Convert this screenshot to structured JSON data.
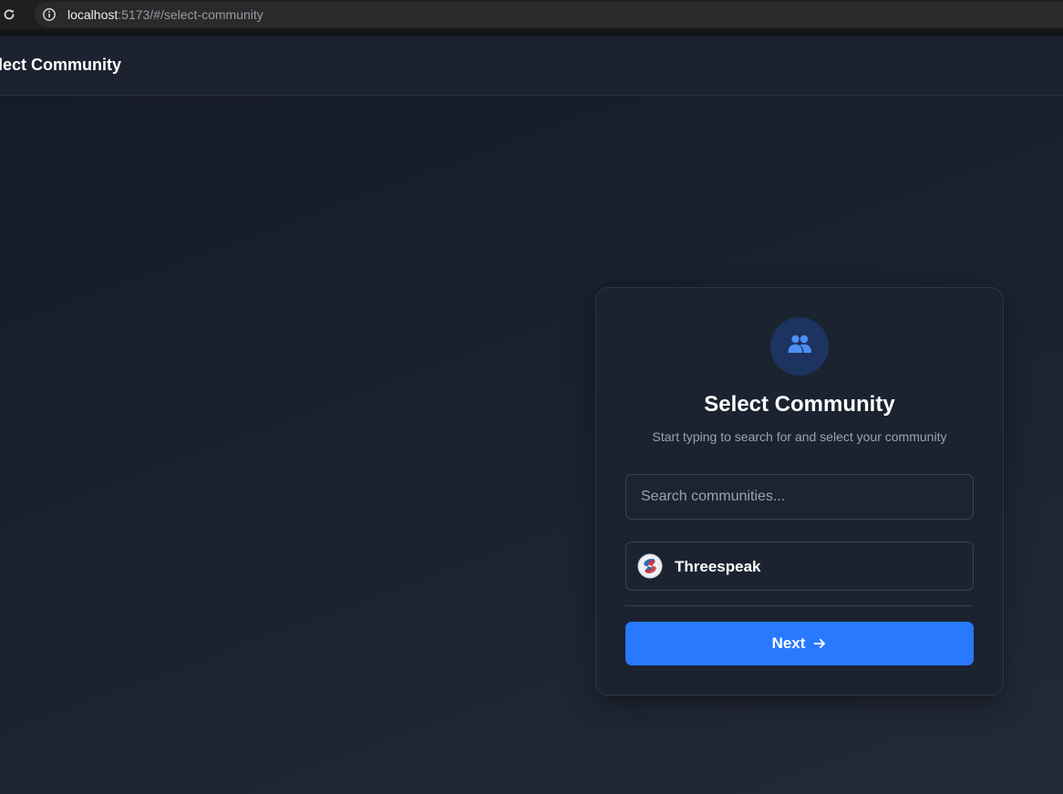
{
  "browser": {
    "url_host": "localhost",
    "url_rest": ":5173/#/select-community"
  },
  "header": {
    "title": "elect Community"
  },
  "card": {
    "icon": "users-icon",
    "title": "Select Community",
    "subtitle": "Start typing to search for and select your community",
    "search": {
      "placeholder": "Search communities...",
      "value": ""
    },
    "communities": [
      {
        "name": "Threespeak",
        "icon": "threespeak-logo-icon"
      }
    ],
    "next_label": "Next"
  },
  "colors": {
    "accent": "#2979ff",
    "icon_bg": "#1d3360",
    "icon_fg": "#4d8ff5",
    "card_bg": "#1b2230",
    "page_bg": "#161b26"
  }
}
